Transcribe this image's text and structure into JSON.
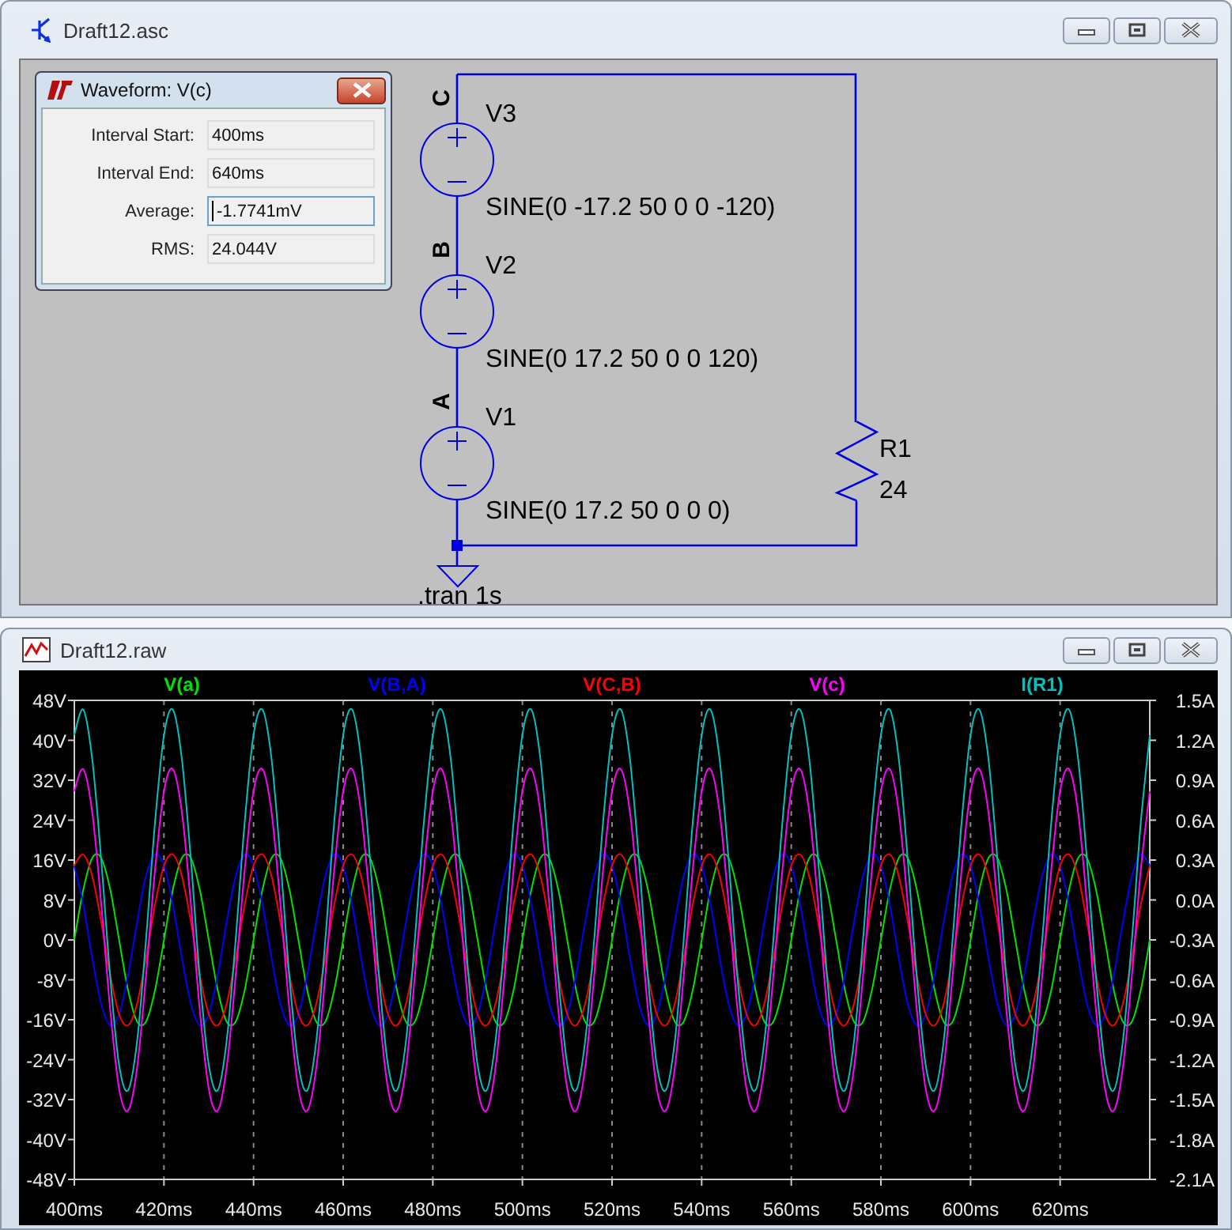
{
  "schematic_window": {
    "title": "Draft12.asc"
  },
  "waveform_dialog": {
    "title": "Waveform: V(c)",
    "fields": [
      {
        "label": "Interval Start:",
        "value": "400ms",
        "focused": false
      },
      {
        "label": "Interval End:",
        "value": "640ms",
        "focused": false
      },
      {
        "label": "Average:",
        "value": "-1.7741mV",
        "focused": true
      },
      {
        "label": "RMS:",
        "value": "24.044V",
        "focused": false
      }
    ]
  },
  "schematic": {
    "node_labels": [
      "C",
      "B",
      "A"
    ],
    "sources": [
      {
        "name": "V3",
        "value": "SINE(0 -17.2 50 0 0 -120)"
      },
      {
        "name": "V2",
        "value": "SINE(0 17.2 50 0 0 120)"
      },
      {
        "name": "V1",
        "value": "SINE(0 17.2 50 0 0 0)"
      }
    ],
    "resistor": {
      "name": "R1",
      "value": "24"
    },
    "directive": ".tran 1s"
  },
  "plot_window": {
    "title": "Draft12.raw",
    "chart_data": {
      "type": "line",
      "x": [
        400,
        402,
        404,
        406,
        408,
        410,
        412,
        414,
        416,
        418,
        420,
        422,
        424,
        426,
        428,
        430,
        432,
        434,
        436,
        438,
        440,
        442,
        444,
        446,
        448,
        450,
        452,
        454,
        456,
        458,
        460,
        462,
        464,
        466,
        468,
        470,
        472,
        474,
        476,
        478,
        480,
        482,
        484,
        486,
        488,
        490,
        492,
        494,
        496,
        498,
        500,
        502,
        504,
        506,
        508,
        510,
        512,
        514,
        516,
        518,
        520,
        522,
        524,
        526,
        528,
        530,
        532,
        534,
        536,
        538,
        540,
        542,
        544,
        546,
        548,
        550,
        552,
        554,
        556,
        558,
        560,
        562,
        564,
        566,
        568,
        570,
        572,
        574,
        576,
        578,
        580,
        582,
        584,
        586,
        588,
        590,
        592,
        594,
        596,
        598,
        600,
        602,
        604,
        606,
        608,
        610,
        612,
        614,
        616,
        618,
        620,
        622,
        624,
        626,
        628,
        630,
        632,
        634,
        636,
        638,
        640
      ],
      "grid": true,
      "xlim": [
        400,
        640
      ],
      "ylim": [
        -48,
        48
      ],
      "y2lim": [
        -2.1,
        1.5
      ],
      "xticks": [
        {
          "value": 400,
          "label": "400ms"
        },
        {
          "value": 420,
          "label": "420ms"
        },
        {
          "value": 440,
          "label": "440ms"
        },
        {
          "value": 460,
          "label": "460ms"
        },
        {
          "value": 480,
          "label": "480ms"
        },
        {
          "value": 500,
          "label": "500ms"
        },
        {
          "value": 520,
          "label": "520ms"
        },
        {
          "value": 540,
          "label": "540ms"
        },
        {
          "value": 560,
          "label": "560ms"
        },
        {
          "value": 580,
          "label": "580ms"
        },
        {
          "value": 600,
          "label": "600ms"
        },
        {
          "value": 620,
          "label": "620ms"
        }
      ],
      "yticks": [
        {
          "value": 48,
          "label": "48V"
        },
        {
          "value": 40,
          "label": "40V"
        },
        {
          "value": 32,
          "label": "32V"
        },
        {
          "value": 24,
          "label": "24V"
        },
        {
          "value": 16,
          "label": "16V"
        },
        {
          "value": 8,
          "label": "8V"
        },
        {
          "value": 0,
          "label": "0V"
        },
        {
          "value": -8,
          "label": "-8V"
        },
        {
          "value": -16,
          "label": "-16V"
        },
        {
          "value": -24,
          "label": "-24V"
        },
        {
          "value": -32,
          "label": "-32V"
        },
        {
          "value": -40,
          "label": "-40V"
        },
        {
          "value": -48,
          "label": "-48V"
        }
      ],
      "y2ticks": [
        {
          "value": 1.5,
          "label": "1.5A"
        },
        {
          "value": 1.2,
          "label": "1.2A"
        },
        {
          "value": 0.9,
          "label": "0.9A"
        },
        {
          "value": 0.6,
          "label": "0.6A"
        },
        {
          "value": 0.3,
          "label": "0.3A"
        },
        {
          "value": 0,
          "label": "0.0A"
        },
        {
          "value": -0.3,
          "label": "-0.3A"
        },
        {
          "value": -0.6,
          "label": "-0.6A"
        },
        {
          "value": -0.9,
          "label": "-0.9A"
        },
        {
          "value": -1.2,
          "label": "-1.2A"
        },
        {
          "value": -1.5,
          "label": "-1.5A"
        },
        {
          "value": -1.8,
          "label": "-1.8A"
        },
        {
          "value": -2.1,
          "label": "-2.1A"
        }
      ],
      "series": [
        {
          "name": "V(a)",
          "color": "#00e000",
          "axis": "y",
          "values": [
            0,
            10.1,
            16.4,
            16.4,
            10.1,
            0,
            -10.1,
            -16.4,
            -16.4,
            -10.1,
            0,
            10.1,
            16.4,
            16.4,
            10.1,
            0,
            -10.1,
            -16.4,
            -16.4,
            -10.1,
            0,
            10.1,
            16.4,
            16.4,
            10.1,
            0,
            -10.1,
            -16.4,
            -16.4,
            -10.1,
            0,
            10.1,
            16.4,
            16.4,
            10.1,
            0,
            -10.1,
            -16.4,
            -16.4,
            -10.1,
            0,
            10.1,
            16.4,
            16.4,
            10.1,
            0,
            -10.1,
            -16.4,
            -16.4,
            -10.1,
            0,
            10.1,
            16.4,
            16.4,
            10.1,
            0,
            -10.1,
            -16.4,
            -16.4,
            -10.1,
            0,
            10.1,
            16.4,
            16.4,
            10.1,
            0,
            -10.1,
            -16.4,
            -16.4,
            -10.1,
            0,
            10.1,
            16.4,
            16.4,
            10.1,
            0,
            -10.1,
            -16.4,
            -16.4,
            -10.1,
            0,
            10.1,
            16.4,
            16.4,
            10.1,
            0,
            -10.1,
            -16.4,
            -16.4,
            -10.1,
            0,
            10.1,
            16.4,
            16.4,
            10.1,
            0,
            -10.1,
            -16.4,
            -16.4,
            -10.1,
            0,
            10.1,
            16.4,
            16.4,
            10.1,
            0,
            -10.1,
            -16.4,
            -16.4,
            -10.1,
            0,
            10.1,
            16.4,
            16.4,
            10.1,
            0,
            -10.1,
            -16.4,
            -16.4,
            -10.1,
            0
          ]
        },
        {
          "name": "V(B,A)",
          "color": "#0000ff",
          "axis": "y",
          "values": [
            14.9,
            7,
            -3.6,
            -12.8,
            -17.1,
            -14.9,
            -7,
            3.6,
            12.8,
            17.1,
            14.9,
            7,
            -3.6,
            -12.8,
            -17.1,
            -14.9,
            -7,
            3.6,
            12.8,
            17.1,
            14.9,
            7,
            -3.6,
            -12.8,
            -17.1,
            -14.9,
            -7,
            3.6,
            12.8,
            17.1,
            14.9,
            7,
            -3.6,
            -12.8,
            -17.1,
            -14.9,
            -7,
            3.6,
            12.8,
            17.1,
            14.9,
            7,
            -3.6,
            -12.8,
            -17.1,
            -14.9,
            -7,
            3.6,
            12.8,
            17.1,
            14.9,
            7,
            -3.6,
            -12.8,
            -17.1,
            -14.9,
            -7,
            3.6,
            12.8,
            17.1,
            14.9,
            7,
            -3.6,
            -12.8,
            -17.1,
            -14.9,
            -7,
            3.6,
            12.8,
            17.1,
            14.9,
            7,
            -3.6,
            -12.8,
            -17.1,
            -14.9,
            -7,
            3.6,
            12.8,
            17.1,
            14.9,
            7,
            -3.6,
            -12.8,
            -17.1,
            -14.9,
            -7,
            3.6,
            12.8,
            17.1,
            14.9,
            7,
            -3.6,
            -12.8,
            -17.1,
            -14.9,
            -7,
            3.6,
            12.8,
            17.1,
            14.9,
            7,
            -3.6,
            -12.8,
            -17.1,
            -14.9,
            -7,
            3.6,
            12.8,
            17.1,
            14.9,
            7,
            -3.6,
            -12.8,
            -17.1,
            -14.9,
            -7,
            3.6,
            12.8,
            17.1,
            14.9
          ]
        },
        {
          "name": "V(C,B)",
          "color": "#ff0000",
          "axis": "y",
          "values": [
            14.9,
            17.1,
            12.8,
            3.6,
            -7,
            -14.9,
            -17.1,
            -12.8,
            -3.6,
            7,
            14.9,
            17.1,
            12.8,
            3.6,
            -7,
            -14.9,
            -17.1,
            -12.8,
            -3.6,
            7,
            14.9,
            17.1,
            12.8,
            3.6,
            -7,
            -14.9,
            -17.1,
            -12.8,
            -3.6,
            7,
            14.9,
            17.1,
            12.8,
            3.6,
            -7,
            -14.9,
            -17.1,
            -12.8,
            -3.6,
            7,
            14.9,
            17.1,
            12.8,
            3.6,
            -7,
            -14.9,
            -17.1,
            -12.8,
            -3.6,
            7,
            14.9,
            17.1,
            12.8,
            3.6,
            -7,
            -14.9,
            -17.1,
            -12.8,
            -3.6,
            7,
            14.9,
            17.1,
            12.8,
            3.6,
            -7,
            -14.9,
            -17.1,
            -12.8,
            -3.6,
            7,
            14.9,
            17.1,
            12.8,
            3.6,
            -7,
            -14.9,
            -17.1,
            -12.8,
            -3.6,
            7,
            14.9,
            17.1,
            12.8,
            3.6,
            -7,
            -14.9,
            -17.1,
            -12.8,
            -3.6,
            7,
            14.9,
            17.1,
            12.8,
            3.6,
            -7,
            -14.9,
            -17.1,
            -12.8,
            -3.6,
            7,
            14.9,
            17.1,
            12.8,
            3.6,
            -7,
            -14.9,
            -17.1,
            -12.8,
            -3.6,
            7,
            14.9,
            17.1,
            12.8,
            3.6,
            -7,
            -14.9,
            -17.1,
            -12.8,
            -3.6,
            7,
            14.9
          ]
        },
        {
          "name": "V(c)",
          "color": "#ff00ff",
          "axis": "y",
          "values": [
            29.8,
            34.2,
            25.6,
            7.2,
            -14,
            -29.8,
            -34.2,
            -25.6,
            -7.2,
            14,
            29.8,
            34.2,
            25.6,
            7.2,
            -14,
            -29.8,
            -34.2,
            -25.6,
            -7.2,
            14,
            29.8,
            34.2,
            25.6,
            7.2,
            -14,
            -29.8,
            -34.2,
            -25.6,
            -7.2,
            14,
            29.8,
            34.2,
            25.6,
            7.2,
            -14,
            -29.8,
            -34.2,
            -25.6,
            -7.2,
            14,
            29.8,
            34.2,
            25.6,
            7.2,
            -14,
            -29.8,
            -34.2,
            -25.6,
            -7.2,
            14,
            29.8,
            34.2,
            25.6,
            7.2,
            -14,
            -29.8,
            -34.2,
            -25.6,
            -7.2,
            14,
            29.8,
            34.2,
            25.6,
            7.2,
            -14,
            -29.8,
            -34.2,
            -25.6,
            -7.2,
            14,
            29.8,
            34.2,
            25.6,
            7.2,
            -14,
            -29.8,
            -34.2,
            -25.6,
            -7.2,
            14,
            29.8,
            34.2,
            25.6,
            7.2,
            -14,
            -29.8,
            -34.2,
            -25.6,
            -7.2,
            14,
            29.8,
            34.2,
            25.6,
            7.2,
            -14,
            -29.8,
            -34.2,
            -25.6,
            -7.2,
            14,
            29.8,
            34.2,
            25.6,
            7.2,
            -14,
            -29.8,
            -34.2,
            -25.6,
            -7.2,
            14,
            29.8,
            34.2,
            25.6,
            7.2,
            -14,
            -29.8,
            -34.2,
            -25.6,
            -7.2,
            14,
            29.8
          ]
        },
        {
          "name": "I(R1)",
          "color": "#00c0c0",
          "axis": "y2",
          "values": [
            1.24,
            1.43,
            1.06,
            0.3,
            -0.58,
            -1.24,
            -1.43,
            -1.06,
            -0.3,
            0.58,
            1.24,
            1.43,
            1.06,
            0.3,
            -0.58,
            -1.24,
            -1.43,
            -1.06,
            -0.3,
            0.58,
            1.24,
            1.43,
            1.06,
            0.3,
            -0.58,
            -1.24,
            -1.43,
            -1.06,
            -0.3,
            0.58,
            1.24,
            1.43,
            1.06,
            0.3,
            -0.58,
            -1.24,
            -1.43,
            -1.06,
            -0.3,
            0.58,
            1.24,
            1.43,
            1.06,
            0.3,
            -0.58,
            -1.24,
            -1.43,
            -1.06,
            -0.3,
            0.58,
            1.24,
            1.43,
            1.06,
            0.3,
            -0.58,
            -1.24,
            -1.43,
            -1.06,
            -0.3,
            0.58,
            1.24,
            1.43,
            1.06,
            0.3,
            -0.58,
            -1.24,
            -1.43,
            -1.06,
            -0.3,
            0.58,
            1.24,
            1.43,
            1.06,
            0.3,
            -0.58,
            -1.24,
            -1.43,
            -1.06,
            -0.3,
            0.58,
            1.24,
            1.43,
            1.06,
            0.3,
            -0.58,
            -1.24,
            -1.43,
            -1.06,
            -0.3,
            0.58,
            1.24,
            1.43,
            1.06,
            0.3,
            -0.58,
            -1.24,
            -1.43,
            -1.06,
            -0.3,
            0.58,
            1.24,
            1.43,
            1.06,
            0.3,
            -0.58,
            -1.24,
            -1.43,
            -1.06,
            -0.3,
            0.58,
            1.24,
            1.43,
            1.06,
            0.3,
            -0.58,
            -1.24,
            -1.43,
            -1.06,
            -0.3,
            0.58,
            1.24
          ]
        }
      ]
    }
  }
}
